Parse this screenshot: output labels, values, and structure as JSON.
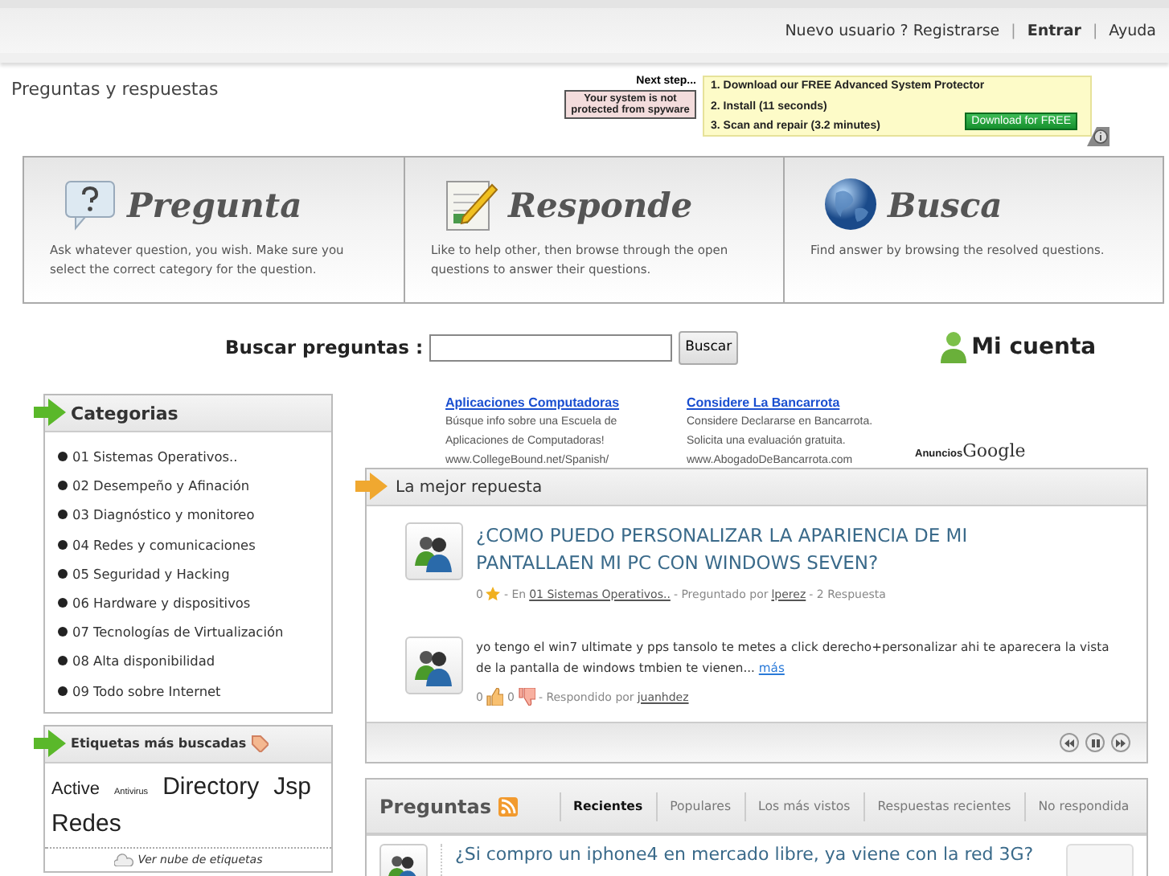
{
  "top_bar": {
    "separator": "|",
    "links": [
      {
        "text": "Nuevo usuario ? Registrarse",
        "bold": false
      },
      {
        "text": "Entrar",
        "bold": true
      },
      {
        "text": "Ayuda",
        "bold": false
      }
    ]
  },
  "page_title": "Preguntas y respuestas",
  "ad_banner": {
    "heading": "Next step...",
    "warning": "Your system is not protected from spyware",
    "steps": [
      "1. Download our FREE Advanced System Protector",
      "2. Install (11 seconds)",
      "3. Scan and repair (3.2 minutes)"
    ],
    "button": "Download for FREE"
  },
  "features": [
    {
      "kind": "ask",
      "title": "Pregunta",
      "text": "Ask whatever question, you wish. Make sure you select the correct category for the question."
    },
    {
      "kind": "answer",
      "title": "Responde",
      "text": "Like to help other, then browse through the open questions to answer their questions."
    },
    {
      "kind": "search",
      "title": "Busca",
      "text": "Find answer by browsing the resolved questions."
    }
  ],
  "search": {
    "label": "Buscar preguntas :",
    "button": "Buscar"
  },
  "account_link": "Mi cuenta",
  "categories": {
    "title": "Categorias",
    "items": [
      "01 Sistemas Operativos..",
      "02 Desempeño y Afinación",
      "03 Diagnóstico y monitoreo",
      "04 Redes y comunicaciones",
      "05 Seguridad y Hacking",
      "06 Hardware y dispositivos",
      "07 Tecnologías de Virtualización",
      "08 Alta disponibilidad",
      "09 Todo sobre Internet"
    ]
  },
  "tags": {
    "title": "Etiquetas más buscadas",
    "items": [
      {
        "text": "Active",
        "kind": "normal"
      },
      {
        "text": "Antivirus",
        "kind": "minor"
      },
      {
        "text": "Directory",
        "kind": "major"
      },
      {
        "text": "Jsp",
        "kind": "major"
      },
      {
        "text": "Redes",
        "kind": "major"
      }
    ],
    "footer": "Ver nube de etiquetas"
  },
  "ads": {
    "items": [
      {
        "title": "Aplicaciones Computadoras",
        "text": "Búsque info sobre una Escuela de Aplicaciones de Computadoras!",
        "url": "www.CollegeBound.net/Spanish/"
      },
      {
        "title": "Considere La Bancarrota",
        "text": "Considere Declararse en Bancarrota. Solicita una evaluación gratuita.",
        "url": "www.AbogadoDeBancarrota.com"
      }
    ],
    "attribution": [
      "Anuncios",
      "Google"
    ]
  },
  "best_answer": {
    "title": "La mejor repuesta",
    "question": "¿COMO PUEDO PERSONALIZAR LA APARIENCIA DE MI PANTALLAEN MI PC CON WINDOWS SEVEN?",
    "question_meta": {
      "stars": "0",
      "in": "- En",
      "category": "01 Sistemas Operativos..",
      "asked": "- Preguntado por",
      "user": "lperez",
      "answers": "- 2 Respuesta"
    },
    "answer": "yo tengo el win7 ultimate y pps tansolo te metes a click derecho+personalizar ahi te aparecera la vista de la pantalla de windows tmbien te vienen...",
    "more": "más",
    "answer_meta": {
      "likes": "0",
      "dislikes": "0",
      "answered": "- Respondido por",
      "user": "juanhdez"
    }
  },
  "questions": {
    "title": "Preguntas",
    "tabs": [
      {
        "label": "Recientes",
        "selected": true
      },
      {
        "label": "Populares",
        "selected": false
      },
      {
        "label": "Los más vistos",
        "selected": false
      },
      {
        "label": "Respuestas recientes",
        "selected": false
      },
      {
        "label": "No respondida",
        "selected": false
      }
    ],
    "items": [
      "¿Si compro un iphone4 en mercado libre, ya viene con la red 3G?"
    ]
  }
}
